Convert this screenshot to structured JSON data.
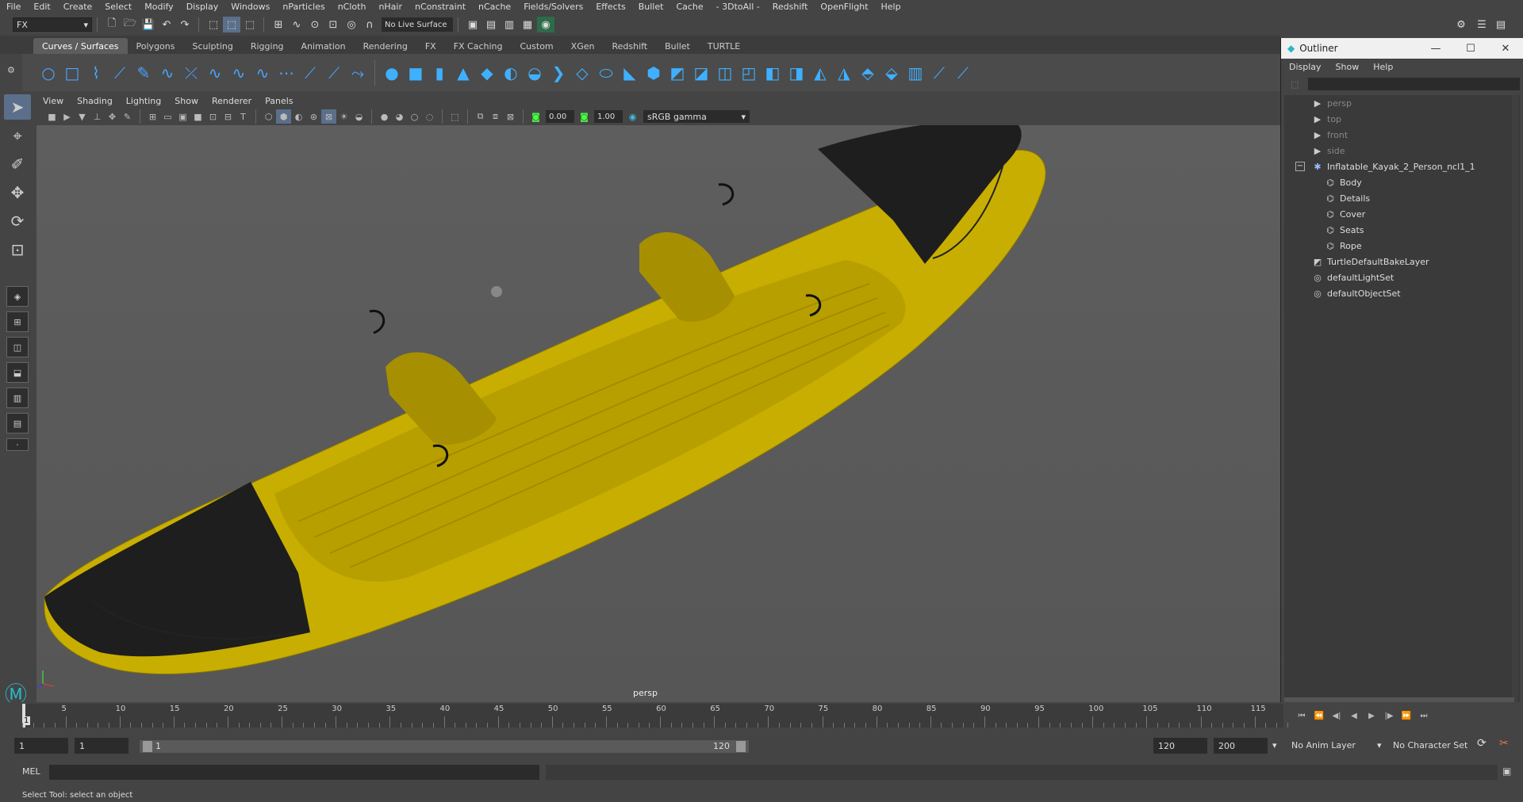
{
  "menus": [
    "File",
    "Edit",
    "Create",
    "Select",
    "Modify",
    "Display",
    "Windows",
    "nParticles",
    "nCloth",
    "nHair",
    "nConstraint",
    "nCache",
    "Fields/Solvers",
    "Effects",
    "Bullet",
    "Cache",
    "- 3DtoAll -",
    "Redshift",
    "OpenFlight",
    "Help"
  ],
  "status": {
    "mode": "FX",
    "live_surface": "No Live Surface"
  },
  "shelf_tabs": [
    "Curves / Surfaces",
    "Polygons",
    "Sculpting",
    "Rigging",
    "Animation",
    "Rendering",
    "FX",
    "FX Caching",
    "Custom",
    "XGen",
    "Redshift",
    "Bullet",
    "TURTLE"
  ],
  "active_shelf": "Curves / Surfaces",
  "panel_menus": [
    "View",
    "Shading",
    "Lighting",
    "Show",
    "Renderer",
    "Panels"
  ],
  "panel_toolbar": {
    "exposure": "0.00",
    "gamma": "1.00",
    "color_space": "sRGB gamma"
  },
  "viewport": {
    "camera_label": "persp",
    "kayak_color": "#c8ae00",
    "cover_color": "#1e1e1e"
  },
  "outliner": {
    "title": "Outliner",
    "menus": [
      "Display",
      "Show",
      "Help"
    ],
    "items": [
      {
        "label": "persp",
        "indent": 1,
        "icon": "camera-icon",
        "dim": true
      },
      {
        "label": "top",
        "indent": 1,
        "icon": "camera-icon",
        "dim": true
      },
      {
        "label": "front",
        "indent": 1,
        "icon": "camera-icon",
        "dim": true
      },
      {
        "label": "side",
        "indent": 1,
        "icon": "camera-icon",
        "dim": true
      },
      {
        "label": "Inflatable_Kayak_2_Person_ncl1_1",
        "indent": 0,
        "icon": "group-icon",
        "dim": false,
        "expander": "−"
      },
      {
        "label": "Body",
        "indent": 2,
        "icon": "mesh-icon",
        "dim": false
      },
      {
        "label": "Details",
        "indent": 2,
        "icon": "mesh-icon",
        "dim": false
      },
      {
        "label": "Cover",
        "indent": 2,
        "icon": "mesh-icon",
        "dim": false
      },
      {
        "label": "Seats",
        "indent": 2,
        "icon": "mesh-icon",
        "dim": false
      },
      {
        "label": "Rope",
        "indent": 2,
        "icon": "mesh-icon",
        "dim": false
      },
      {
        "label": "TurtleDefaultBakeLayer",
        "indent": 1,
        "icon": "bake-layer-icon",
        "dim": false
      },
      {
        "label": "defaultLightSet",
        "indent": 1,
        "icon": "set-icon",
        "dim": false
      },
      {
        "label": "defaultObjectSet",
        "indent": 1,
        "icon": "set-icon",
        "dim": false
      }
    ]
  },
  "timeline": {
    "current_frame": "1",
    "ticks": [
      "5",
      "10",
      "15",
      "20",
      "25",
      "30",
      "35",
      "40",
      "45",
      "50",
      "55",
      "60",
      "65",
      "70",
      "75",
      "80",
      "85",
      "90",
      "95",
      "100",
      "105",
      "110",
      "115"
    ]
  },
  "range": {
    "start": "1",
    "playback_start": "1",
    "slider_start": "1",
    "slider_end": "120",
    "playback_end": "120",
    "end": "200",
    "anim_layer": "No Anim Layer",
    "character_set": "No Character Set"
  },
  "command": {
    "language": "MEL"
  },
  "help_text": "Select Tool: select an object"
}
